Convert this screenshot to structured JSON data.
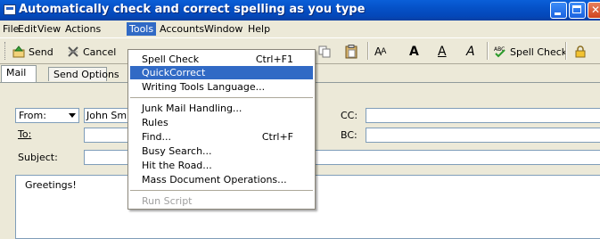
{
  "window": {
    "title": "Automatically check and correct spelling as you type"
  },
  "menubar": {
    "items": [
      "File",
      "Edit",
      "View",
      "Actions",
      "Tools",
      "Accounts",
      "Window",
      "Help"
    ],
    "active": "Tools"
  },
  "toolbar": {
    "send_label": "Send",
    "cancel_label": "Cancel",
    "spell_check_label": "Spell Check",
    "font_letters": [
      "A",
      "A",
      "A",
      "A"
    ],
    "font_letter_shrink": "A"
  },
  "tabs": [
    "Mail",
    "Send Options"
  ],
  "form": {
    "from_label": "From:",
    "from_value": "John Smit",
    "to_label": "To:",
    "subject_label": "Subject:",
    "cc_label": "CC:",
    "bc_label": "BC:",
    "body_text": "Greetings!"
  },
  "tools_menu": {
    "items": [
      {
        "label": "Spell Check",
        "shortcut": "Ctrl+F1"
      },
      {
        "label": "QuickCorrect",
        "shortcut": ""
      },
      {
        "label": "Writing Tools Language...",
        "shortcut": ""
      },
      {
        "label": "Junk Mail Handling...",
        "shortcut": ""
      },
      {
        "label": "Rules",
        "shortcut": ""
      },
      {
        "label": "Find...",
        "shortcut": "Ctrl+F"
      },
      {
        "label": "Busy Search...",
        "shortcut": ""
      },
      {
        "label": "Hit the Road...",
        "shortcut": ""
      },
      {
        "label": "Mass Document Operations...",
        "shortcut": ""
      },
      {
        "label": "Run Script",
        "shortcut": ""
      }
    ],
    "highlighted": "QuickCorrect",
    "disabled": [
      "Run Script"
    ]
  },
  "colors": {
    "titlebar": "#0551c7",
    "highlight": "#316ac5",
    "chrome": "#ece9d8"
  },
  "icons": [
    "app-icon",
    "send-icon",
    "cancel-icon",
    "copy-icon",
    "paste-icon",
    "spell-check-icon",
    "lock-icon",
    "dropdown-arrow-icon"
  ]
}
